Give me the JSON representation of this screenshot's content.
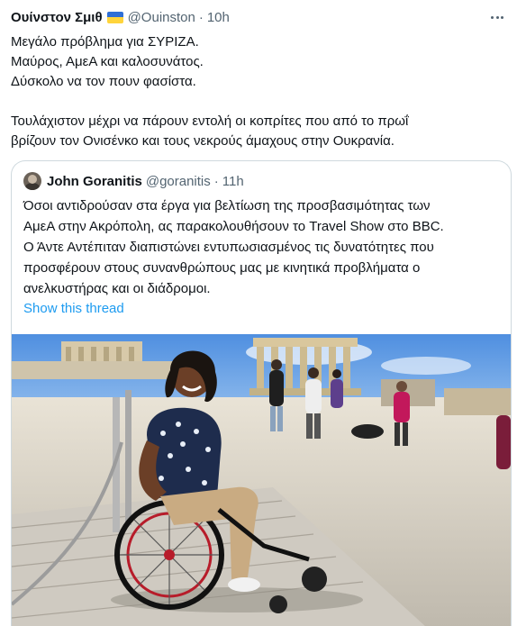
{
  "tweet": {
    "author_name": "Ουίνστον Σμιθ",
    "author_flag_icon": "ukraine-flag-icon",
    "handle": "@Ouinston",
    "separator": "·",
    "time": "10h",
    "more_icon": "more-horizontal-icon",
    "lines": [
      "Μεγάλο πρόβλημα για ΣΥΡΙΖΑ.",
      "Μαύρος, ΑμεΑ και καλοσυνάτος.",
      "Δύσκολο να τον πουν φασίστα.",
      "",
      "Τουλάχιστον μέχρι να πάρουν εντολή οι κοπρίτες που από το πρωΐ",
      "βρίζουν τον Ονισένκο και τους νεκρούς άμαχους στην Ουκρανία."
    ]
  },
  "quoted": {
    "author_name": "John Goranitis",
    "handle": "@goranitis",
    "separator": "·",
    "time": "11h",
    "lines": [
      "Όσοι αντιδρούσαν στα έργα για βελτίωση της προσβασιμότητας των",
      "ΑμεΑ στην Ακρόπολη, ας παρακολουθήσουν το Travel Show στο BBC.",
      "Ο Άντε Αντέπιταν διαπιστώνει εντυπωσιασμένος τις δυνατότητες που",
      "προσφέρουν στους συνανθρώπους μας με κινητικά προβλήματα ο",
      "ανελκυστήρας και οι διάδρομοι."
    ],
    "show_thread": "Show this thread"
  },
  "colors": {
    "text": "#0f1419",
    "secondary": "#536471",
    "link": "#1d9bf0",
    "border": "#cfd9de",
    "flag_blue": "#2f6fd6",
    "flag_yellow": "#ffd43b"
  }
}
